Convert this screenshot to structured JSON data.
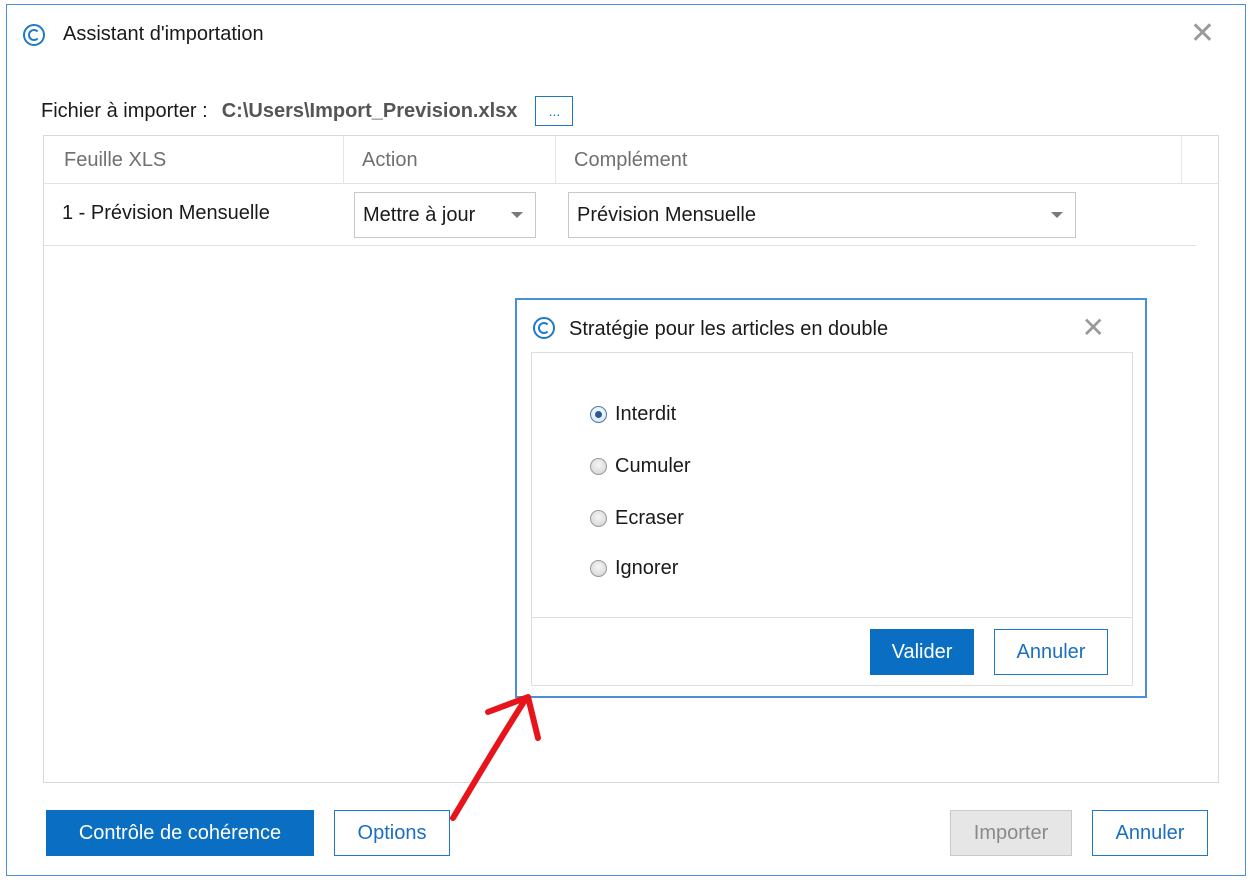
{
  "window": {
    "title": "Assistant d'importation",
    "icon": "app-logo-icon",
    "close_glyph": "✕"
  },
  "file": {
    "label": "Fichier à importer :",
    "path": "C:\\Users\\Import_Prevision.xlsx",
    "browse_label": "..."
  },
  "grid": {
    "columns": [
      "Feuille XLS",
      "Action",
      "Complément"
    ],
    "rows": [
      {
        "sheet": "1 - Prévision Mensuelle",
        "action": "Mettre à jour",
        "complement": "Prévision Mensuelle"
      }
    ]
  },
  "footer": {
    "coherence_label": "Contrôle de cohérence",
    "options_label": "Options",
    "import_label": "Importer",
    "cancel_label": "Annuler"
  },
  "modal": {
    "title": "Stratégie pour les articles en double",
    "close_glyph": "✕",
    "options": [
      {
        "label": "Interdit",
        "checked": true
      },
      {
        "label": "Cumuler",
        "checked": false
      },
      {
        "label": "Ecraser",
        "checked": false
      },
      {
        "label": "Ignorer",
        "checked": false
      }
    ],
    "validate_label": "Valider",
    "cancel_label": "Annuler"
  },
  "colors": {
    "accent": "#0a6fc2",
    "window_border": "#4a90d9",
    "annotation_arrow": "#e8141c"
  }
}
